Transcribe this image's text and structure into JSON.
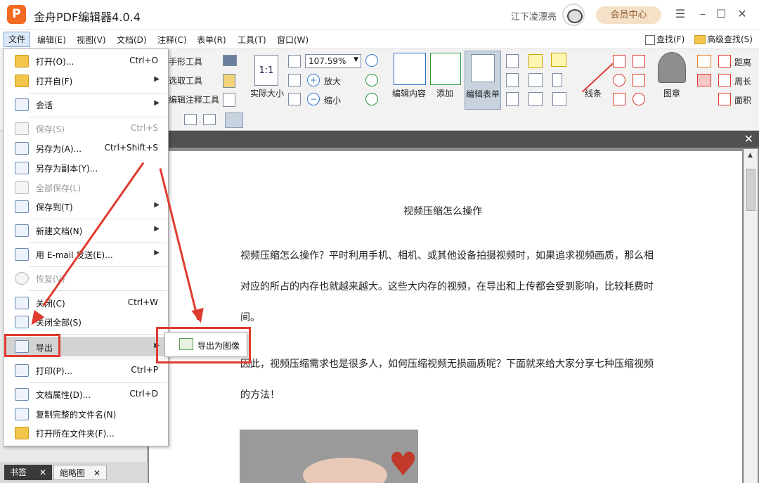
{
  "app": {
    "logo": "P",
    "title": "金舟PDF编辑器4.0.4",
    "user": "江下凌漂亮",
    "member_button": "会员中心",
    "win_menu": "☰",
    "win_minimize": "–",
    "win_maximize": "☐",
    "win_close": "✕"
  },
  "menubar": {
    "items": [
      "文件",
      "编辑(E)",
      "视图(V)",
      "文档(D)",
      "注释(C)",
      "表单(R)",
      "工具(T)",
      "窗口(W)"
    ],
    "find": "查找(F)",
    "advanced_find": "高级查找(S)"
  },
  "ribbon": {
    "hand_tool": "手形工具",
    "select_tool": "选取工具",
    "edit_annot_tool": "编辑注释工具",
    "actual_size": "实际大小",
    "actual_size_icon": "1:1",
    "zoom_value": "107.59%",
    "zoom_in": "放大",
    "zoom_out": "缩小",
    "edit_content": "编辑内容",
    "add": "添加",
    "edit_form": "编辑表单",
    "line": "线条",
    "stamp": "图章",
    "distance": "距离",
    "perimeter": "周长",
    "area": "面积"
  },
  "file_menu": {
    "items": [
      {
        "label": "打开(O)...",
        "shortcut": "Ctrl+O",
        "enabled": true,
        "submenu": false
      },
      {
        "label": "打开自(F)",
        "shortcut": "",
        "enabled": true,
        "submenu": true
      },
      {
        "label": "会话",
        "shortcut": "",
        "enabled": true,
        "submenu": true
      },
      {
        "label": "保存(S)",
        "shortcut": "Ctrl+S",
        "enabled": false,
        "submenu": false
      },
      {
        "label": "另存为(A)...",
        "shortcut": "Ctrl+Shift+S",
        "enabled": true,
        "submenu": false
      },
      {
        "label": "另存为副本(Y)...",
        "shortcut": "",
        "enabled": true,
        "submenu": false
      },
      {
        "label": "全部保存(L)",
        "shortcut": "",
        "enabled": false,
        "submenu": false
      },
      {
        "label": "保存到(T)",
        "shortcut": "",
        "enabled": true,
        "submenu": true
      },
      {
        "label": "新建文档(N)",
        "shortcut": "",
        "enabled": true,
        "submenu": true
      },
      {
        "label": "用 E-mail 发送(E)...",
        "shortcut": "",
        "enabled": true,
        "submenu": true
      },
      {
        "label": "恢复(V)",
        "shortcut": "",
        "enabled": false,
        "submenu": false
      },
      {
        "label": "关闭(C)",
        "shortcut": "Ctrl+W",
        "enabled": true,
        "submenu": false
      },
      {
        "label": "关闭全部(S)",
        "shortcut": "",
        "enabled": true,
        "submenu": false
      },
      {
        "label": "导出",
        "shortcut": "",
        "enabled": true,
        "submenu": true
      },
      {
        "label": "打印(P)...",
        "shortcut": "Ctrl+P",
        "enabled": true,
        "submenu": false
      },
      {
        "label": "文档属性(D)...",
        "shortcut": "Ctrl+D",
        "enabled": true,
        "submenu": false
      },
      {
        "label": "复制完整的文件名(N)",
        "shortcut": "",
        "enabled": true,
        "submenu": false
      },
      {
        "label": "打开所在文件夹(F)...",
        "shortcut": "",
        "enabled": true,
        "submenu": false
      }
    ],
    "submenu_export": {
      "label": "导出为图像"
    }
  },
  "document": {
    "title": "视频压缩怎么操作",
    "paragraphs": [
      "视频压缩怎么操作？平时利用手机、相机、或其他设备拍摄视频时，如果追求视频画质，那么相对应的所占的内存也就越来越大。这些大内存的视频，在导出和上传都会受到影响，比较耗费时间。",
      "因此，视频压缩需求也是很多人，如何压缩视频无损画质呢？下面就来给大家分享七种压缩视频的方法！"
    ]
  },
  "side_panel": {
    "tabs": [
      "书签",
      "缩略图"
    ]
  },
  "colors": {
    "accent_orange": "#f26a22",
    "annotation_red": "#e03b2f",
    "menu_highlight": "#d3d3d3"
  }
}
